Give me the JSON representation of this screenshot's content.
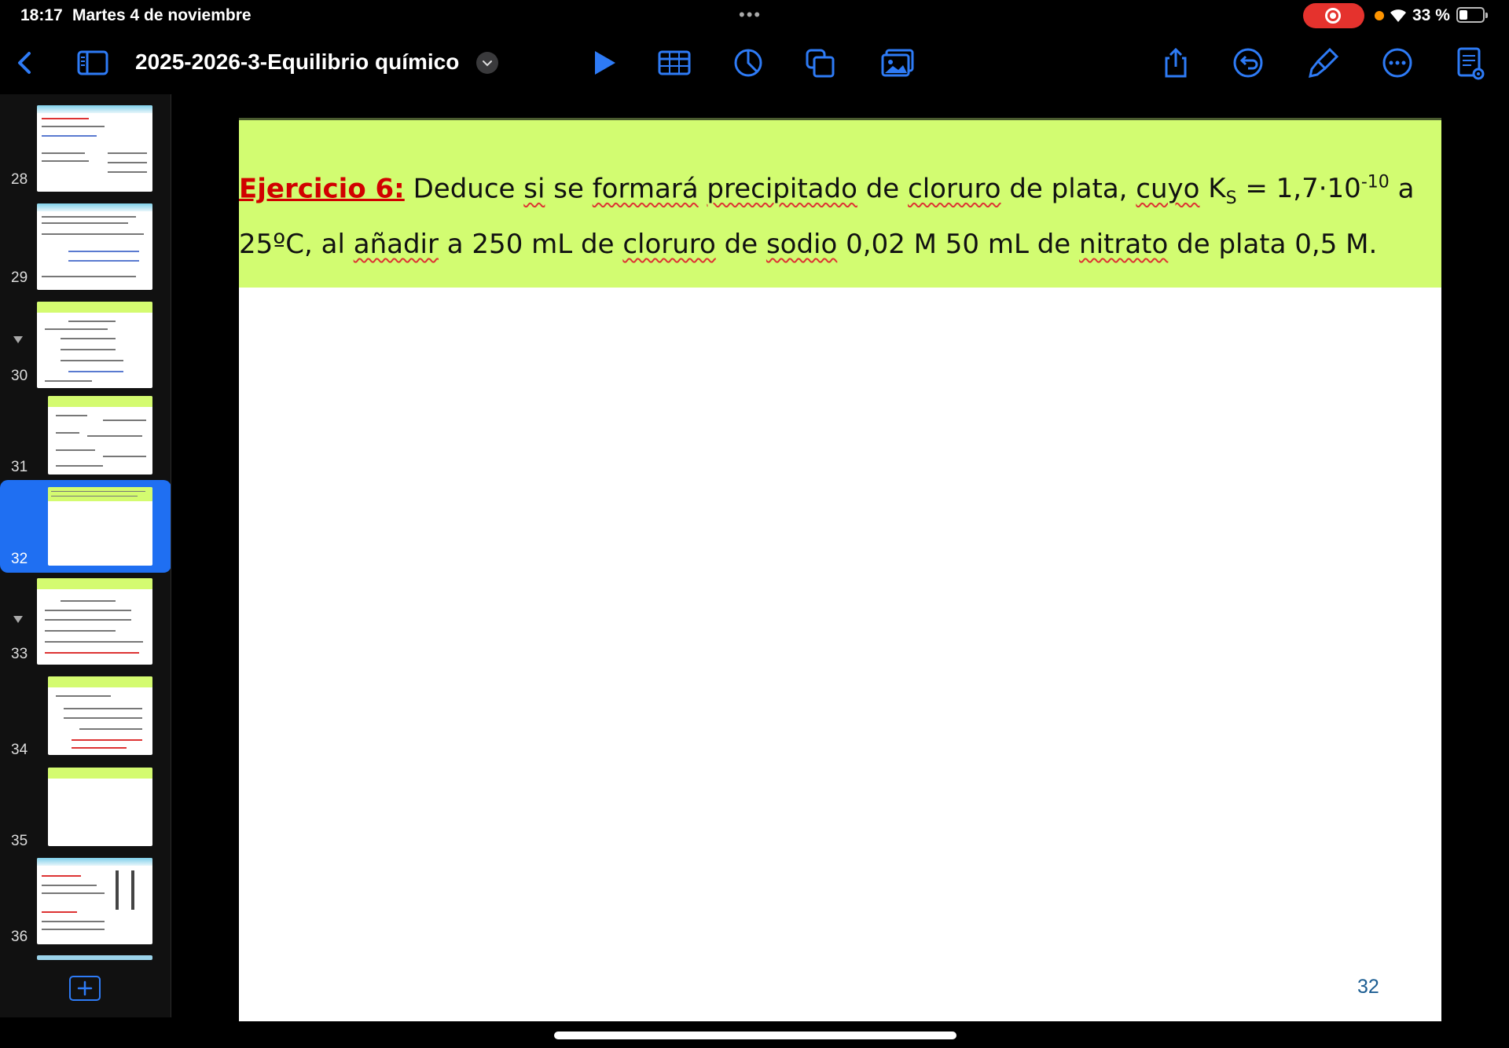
{
  "status": {
    "time": "18:17",
    "date": "Martes 4 de noviembre",
    "dots": "•••",
    "battery": "33 %"
  },
  "toolbar": {
    "title": "2025-2026-3-Equilibrio químico",
    "accent": "#2e7bf6"
  },
  "sidebar": {
    "slides": [
      {
        "num": "28"
      },
      {
        "num": "29"
      },
      {
        "num": "30"
      },
      {
        "num": "31"
      },
      {
        "num": "32"
      },
      {
        "num": "33"
      },
      {
        "num": "34"
      },
      {
        "num": "35"
      },
      {
        "num": "36"
      }
    ]
  },
  "slide": {
    "label": "Ejercicio 6:",
    "w1": "Deduce",
    "w2": "si",
    "w3": "se",
    "w4": "formará",
    "w5": "precipitado",
    "w6": "de",
    "w7": "cloruro",
    "w8": "de plata,",
    "w9": "cuyo",
    "w10": "K",
    "w10sub": "S",
    "w11": "= 1,7·10",
    "w11sup": "-10",
    "w12": "a",
    "l2a": "25ºC, al",
    "l2b": "añadir",
    "l2c": "a 250 mL de",
    "l2d": "cloruro",
    "l2e": "de",
    "l2f": "sodio",
    "l2g": "0,02 M 50 mL de",
    "l2h": "nitrato",
    "l2i": "de plata 0,5 M.",
    "number": "32"
  }
}
